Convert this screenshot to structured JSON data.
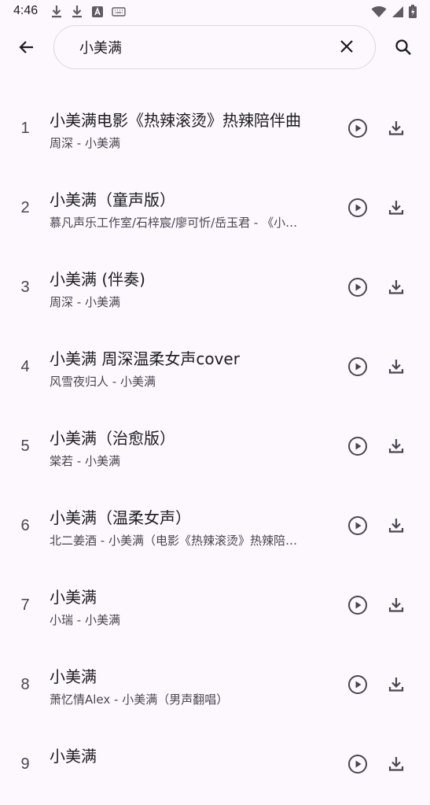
{
  "status_bar": {
    "time": "4:46",
    "left_icons": [
      "download-icon",
      "download-icon",
      "a-badge-icon",
      "keyboard-icon"
    ],
    "right_icons": [
      "wifi-icon",
      "signal-icon",
      "battery-charging-icon"
    ]
  },
  "search": {
    "value": "小美满",
    "back_icon": "arrow-back-icon",
    "clear_icon": "close-icon",
    "search_icon": "search-icon"
  },
  "results": [
    {
      "index": "1",
      "title": "小美满电影《热辣滚烫》热辣陪伴曲",
      "subtitle": "周深 - 小美满"
    },
    {
      "index": "2",
      "title": "小美满（童声版）",
      "subtitle": "慕凡声乐工作室/石梓宸/廖可忻/岳玉君 - 《小…"
    },
    {
      "index": "3",
      "title": "小美满 (伴奏)",
      "subtitle": "周深 - 小美满"
    },
    {
      "index": "4",
      "title": "小美满 周深温柔女声cover",
      "subtitle": "风雪夜归人 - 小美满"
    },
    {
      "index": "5",
      "title": "小美满（治愈版）",
      "subtitle": "棠若 - 小美满"
    },
    {
      "index": "6",
      "title": "小美满（温柔女声）",
      "subtitle": "北二姜酒 - 小美满（电影《热辣滚烫》热辣陪…"
    },
    {
      "index": "7",
      "title": "小美满",
      "subtitle": "小瑞 - 小美满"
    },
    {
      "index": "8",
      "title": "小美满",
      "subtitle": "萧忆情Alex - 小美满（男声翻唱）"
    },
    {
      "index": "9",
      "title": "小美满",
      "subtitle": ""
    }
  ],
  "row_icons": {
    "play": "play-circle-icon",
    "download": "download-icon"
  },
  "colors": {
    "background": "#fdf8fd",
    "text": "#1c1b1f",
    "secondary": "#49454f",
    "icon": "#49454f",
    "outline": "#dcd8de"
  }
}
